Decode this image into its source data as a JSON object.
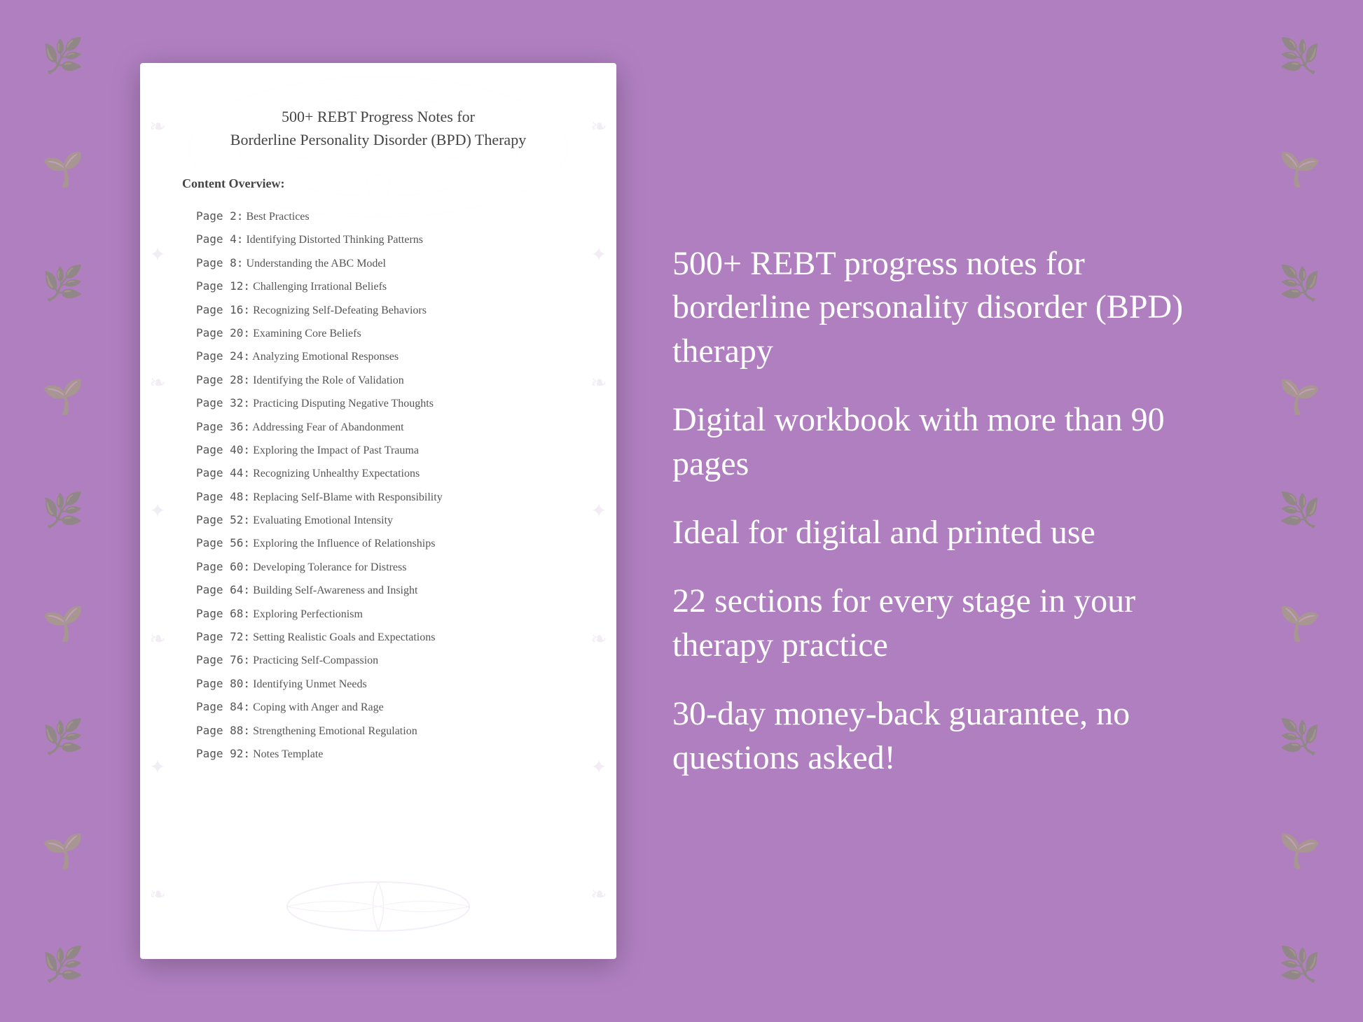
{
  "background_color": "#b07fc0",
  "document": {
    "title_line1": "500+ REBT Progress Notes for",
    "title_line2": "Borderline Personality Disorder (BPD) Therapy",
    "content_label": "Content Overview:",
    "toc": [
      {
        "page": "Page  2:",
        "title": "Best Practices"
      },
      {
        "page": "Page  4:",
        "title": "Identifying Distorted Thinking Patterns"
      },
      {
        "page": "Page  8:",
        "title": "Understanding the ABC Model"
      },
      {
        "page": "Page 12:",
        "title": "Challenging Irrational Beliefs"
      },
      {
        "page": "Page 16:",
        "title": "Recognizing Self-Defeating Behaviors"
      },
      {
        "page": "Page 20:",
        "title": "Examining Core Beliefs"
      },
      {
        "page": "Page 24:",
        "title": "Analyzing Emotional Responses"
      },
      {
        "page": "Page 28:",
        "title": "Identifying the Role of Validation"
      },
      {
        "page": "Page 32:",
        "title": "Practicing Disputing Negative Thoughts"
      },
      {
        "page": "Page 36:",
        "title": "Addressing Fear of Abandonment"
      },
      {
        "page": "Page 40:",
        "title": "Exploring the Impact of Past Trauma"
      },
      {
        "page": "Page 44:",
        "title": "Recognizing Unhealthy Expectations"
      },
      {
        "page": "Page 48:",
        "title": "Replacing Self-Blame with Responsibility"
      },
      {
        "page": "Page 52:",
        "title": "Evaluating Emotional Intensity"
      },
      {
        "page": "Page 56:",
        "title": "Exploring the Influence of Relationships"
      },
      {
        "page": "Page 60:",
        "title": "Developing Tolerance for Distress"
      },
      {
        "page": "Page 64:",
        "title": "Building Self-Awareness and Insight"
      },
      {
        "page": "Page 68:",
        "title": "Exploring Perfectionism"
      },
      {
        "page": "Page 72:",
        "title": "Setting Realistic Goals and Expectations"
      },
      {
        "page": "Page 76:",
        "title": "Practicing Self-Compassion"
      },
      {
        "page": "Page 80:",
        "title": "Identifying Unmet Needs"
      },
      {
        "page": "Page 84:",
        "title": "Coping with Anger and Rage"
      },
      {
        "page": "Page 88:",
        "title": "Strengthening Emotional Regulation"
      },
      {
        "page": "Page 92:",
        "title": "Notes Template"
      }
    ]
  },
  "features": [
    "500+ REBT progress notes for borderline personality disorder (BPD) therapy",
    "Digital workbook with more than 90 pages",
    "Ideal for digital and printed use",
    "22 sections for every stage in your therapy practice",
    "30-day money-back guarantee, no questions asked!"
  ]
}
